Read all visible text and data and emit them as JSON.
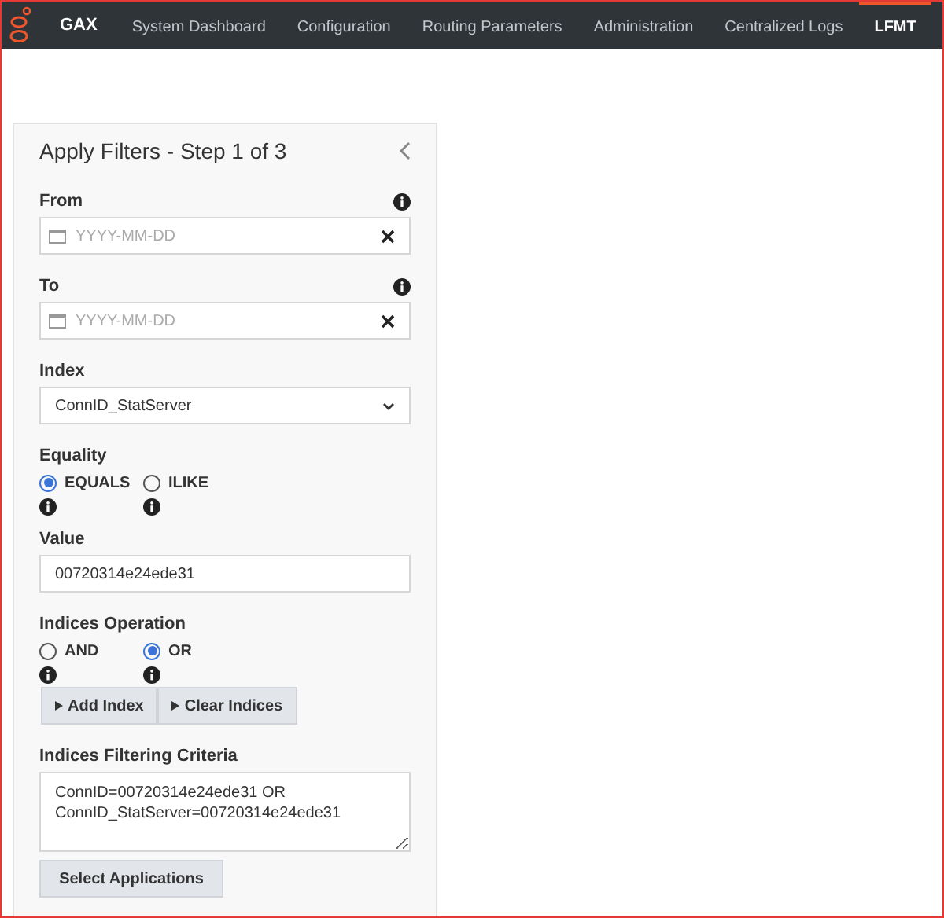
{
  "nav": {
    "brand": "GAX",
    "items": [
      {
        "label": "System Dashboard",
        "selected": false
      },
      {
        "label": "Configuration",
        "selected": false
      },
      {
        "label": "Routing Parameters",
        "selected": false
      },
      {
        "label": "Administration",
        "selected": false
      },
      {
        "label": "Centralized Logs",
        "selected": false
      },
      {
        "label": "LFMT",
        "selected": true
      }
    ]
  },
  "panel": {
    "title": "Apply Filters - Step 1 of 3",
    "from": {
      "label": "From",
      "placeholder": "YYYY-MM-DD"
    },
    "to": {
      "label": "To",
      "placeholder": "YYYY-MM-DD"
    },
    "index": {
      "label": "Index",
      "value": "ConnID_StatServer"
    },
    "equality": {
      "label": "Equality",
      "options": [
        {
          "label": "EQUALS",
          "selected": true
        },
        {
          "label": "ILIKE",
          "selected": false
        }
      ]
    },
    "value": {
      "label": "Value",
      "value": "00720314e24ede31"
    },
    "indices_operation": {
      "label": "Indices Operation",
      "options": [
        {
          "label": "AND",
          "selected": false
        },
        {
          "label": "OR",
          "selected": true
        }
      ]
    },
    "index_buttons": [
      "Add Index",
      "Clear Indices"
    ],
    "criteria": {
      "label": "Indices Filtering Criteria",
      "value": "ConnID=00720314e24ede31 OR\nConnID_StatServer=00720314e24ede31"
    },
    "select_button": "Select Applications"
  }
}
